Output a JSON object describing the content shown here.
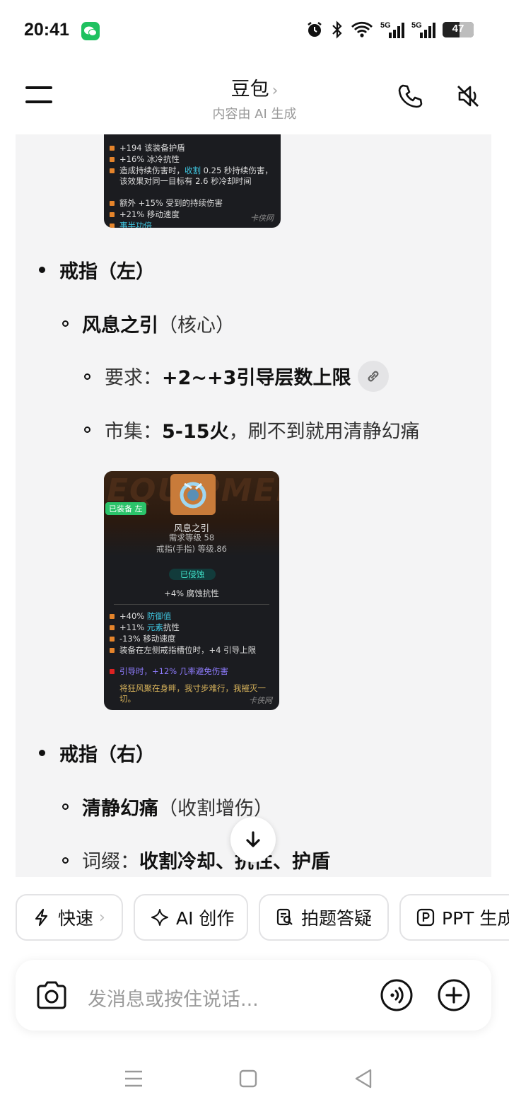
{
  "status": {
    "time": "20:41",
    "battery": "47",
    "signal1": "5G",
    "signal2": "5G"
  },
  "header": {
    "title": "豆包",
    "title_chevron": "›",
    "subtitle": "内容由 AI 生成"
  },
  "card_top": {
    "lines": [
      "+194 该装备护盾",
      "+16% 冰冷抗性",
      "造成持续伤害时，",
      "收割",
      " 0.25 秒持续伤害，该效果对同一目标有 2.6 秒冷却时间",
      "额外 +15% 受到的持续伤害",
      "+21% 移动速度",
      "事半功倍"
    ],
    "signature": "卡侠网"
  },
  "list": {
    "ring_left": "戒指（左）",
    "ring_left_item_name": "风息之引",
    "ring_left_item_tag": "（核心）",
    "req_label": "要求：",
    "req_value": "+2~+3引导层数上限",
    "market_label": "市集：",
    "market_value": "5-15火",
    "market_note": "，刷不到就用清静幻痛",
    "ring_right": "戒指（右）",
    "ring_right_item_name": "清静幻痛",
    "ring_right_item_tag": "（收割增伤）",
    "affix_label": "词缀：",
    "affix_value": "收割冷却、抗性、护盾"
  },
  "card_ring": {
    "bg_text": "EQUIPMENT",
    "equipped_badge": "已装备 左",
    "name": "风息之引",
    "req_level": "需求等级 58",
    "type": "戒指(手指)",
    "level": "等级.86",
    "corrupted": "已侵蚀",
    "implicit": "+4% 腐蚀抗性",
    "mods": [
      {
        "pre": "+40% ",
        "hl": "防御值",
        "post": ""
      },
      {
        "pre": "+11% ",
        "hl": "元素",
        "post": "抗性"
      },
      {
        "pre": "-13% 移动速度",
        "hl": "",
        "post": ""
      },
      {
        "pre": "装备在左侧戒指槽位时，+4 引导上限",
        "hl": "",
        "post": ""
      },
      {
        "pre": "",
        "hl": "引导时，+12% 几率避免伤害",
        "post": ""
      }
    ],
    "flavor": "将狂风聚在身畔，我寸步难行，我摧灭一切。",
    "signature": "卡侠网"
  },
  "chips": [
    {
      "label": "快速",
      "icon": "lightning-icon",
      "chev": "›"
    },
    {
      "label": "AI 创作",
      "icon": "sparkle-icon"
    },
    {
      "label": "拍题答疑",
      "icon": "photo-question-icon"
    },
    {
      "label": "PPT 生成",
      "icon": "ppt-icon"
    }
  ],
  "input": {
    "placeholder": "发消息或按住说话..."
  },
  "colors": {
    "accent_blue": "#3fc6e0",
    "bullet_orange": "#e5842b",
    "content_bg": "#f4f4f5"
  }
}
